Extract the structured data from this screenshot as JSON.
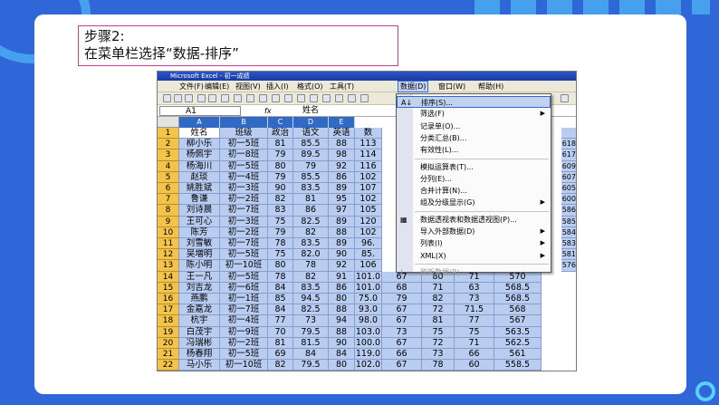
{
  "step": {
    "title": "步骤2:",
    "instruction": "在菜单栏选择“数据-排序”"
  },
  "window": {
    "title": "Microsoft Excel - 初一成绩"
  },
  "menubar": [
    "文件(F)",
    "编辑(E)",
    "视图(V)",
    "插入(I)",
    "格式(O)",
    "工具(T)",
    "数据(D)",
    "窗口(W)",
    "帮助(H)"
  ],
  "formula_bar": {
    "cell_ref": "A1",
    "fx": "fx",
    "content": "姓名"
  },
  "columns": [
    "A",
    "B",
    "C",
    "D",
    "E"
  ],
  "table": {
    "rows": [
      [
        "1",
        "姓名",
        "班级",
        "政治",
        "语文",
        "英语",
        "数"
      ],
      [
        "2",
        "柳小乐",
        "初一5班",
        "81",
        "85.5",
        "88",
        "113"
      ],
      [
        "3",
        "杨佩宇",
        "初一8班",
        "79",
        "89.5",
        "98",
        "114"
      ],
      [
        "4",
        "杨海川",
        "初一5班",
        "80",
        "79",
        "92",
        "116"
      ],
      [
        "5",
        "赵琰",
        "初一4班",
        "79",
        "85.5",
        "86",
        "102"
      ],
      [
        "6",
        "姚胜斌",
        "初一3班",
        "90",
        "83.5",
        "89",
        "107"
      ],
      [
        "7",
        "鲁谦",
        "初一2班",
        "82",
        "81",
        "95",
        "102"
      ],
      [
        "8",
        "刘诗晨",
        "初一7班",
        "83",
        "86",
        "97",
        "105"
      ],
      [
        "9",
        "王可心",
        "初一3班",
        "75",
        "82.5",
        "89",
        "120"
      ],
      [
        "10",
        "陈芳",
        "初一2班",
        "79",
        "82",
        "88",
        "102"
      ],
      [
        "11",
        "刘雪敏",
        "初一7班",
        "78",
        "83.5",
        "89",
        "96."
      ],
      [
        "12",
        "吴増明",
        "初一5班",
        "75",
        "82.0",
        "90",
        "85."
      ],
      [
        "13",
        "陈小明",
        "初一10班",
        "80",
        "78",
        "92",
        "106"
      ],
      [
        "14",
        "王一凡",
        "初一5班",
        "78",
        "82",
        "91",
        "101.0",
        "67",
        "80",
        "71",
        "570"
      ],
      [
        "15",
        "刘吉龙",
        "初一6班",
        "84",
        "83.5",
        "86",
        "101.0",
        "68",
        "71",
        "63",
        "568.5"
      ],
      [
        "16",
        "燕鹏",
        "初一1班",
        "85",
        "94.5",
        "80",
        "75.0",
        "79",
        "82",
        "73",
        "568.5"
      ],
      [
        "17",
        "金嘉龙",
        "初一7班",
        "84",
        "82.5",
        "88",
        "93.0",
        "67",
        "72",
        "71.5",
        "568"
      ],
      [
        "18",
        "杭宇",
        "初一4班",
        "77",
        "73",
        "94",
        "98.0",
        "67",
        "81",
        "77",
        "567"
      ],
      [
        "19",
        "白茂宇",
        "初一9班",
        "70",
        "79.5",
        "88",
        "103.0",
        "73",
        "75",
        "75",
        "563.5"
      ],
      [
        "20",
        "冯瑞彬",
        "初一2班",
        "81",
        "81.5",
        "90",
        "100.0",
        "67",
        "72",
        "71",
        "562.5"
      ],
      [
        "21",
        "杨春翔",
        "初一5班",
        "69",
        "84",
        "84",
        "119.0",
        "66",
        "73",
        "66",
        "561"
      ],
      [
        "22",
        "马小乐",
        "初一10班",
        "82",
        "79.5",
        "80",
        "102.0",
        "67",
        "78",
        "60",
        "558.5"
      ]
    ],
    "right_values": [
      "",
      "618",
      "617",
      "609",
      "607",
      "605",
      "600",
      "586",
      "585",
      "584",
      "583",
      "581",
      "576"
    ]
  },
  "data_menu": [
    {
      "label": "排序(S)...",
      "icon": "sort-az-icon",
      "icon_glyph": "A↓",
      "highlight": true
    },
    {
      "label": "筛选(F)",
      "submenu": true
    },
    {
      "label": "记录单(O)..."
    },
    {
      "label": "分类汇总(B)..."
    },
    {
      "label": "有效性(L)..."
    },
    {
      "separator": true
    },
    {
      "label": "模拟运算表(T)..."
    },
    {
      "label": "分列(E)..."
    },
    {
      "label": "合并计算(N)..."
    },
    {
      "label": "组及分级显示(G)",
      "submenu": true
    },
    {
      "separator": true
    },
    {
      "label": "数据透视表和数据透视图(P)...",
      "icon": "pivot-table-icon",
      "icon_glyph": "▦"
    },
    {
      "label": "导入外部数据(D)",
      "submenu": true
    },
    {
      "label": "列表(I)",
      "submenu": true
    },
    {
      "label": "XML(X)",
      "submenu": true
    },
    {
      "separator": true
    },
    {
      "label": "刷新数据(R)",
      "icon": "refresh-icon",
      "icon_glyph": "!",
      "disabled": true
    }
  ]
}
